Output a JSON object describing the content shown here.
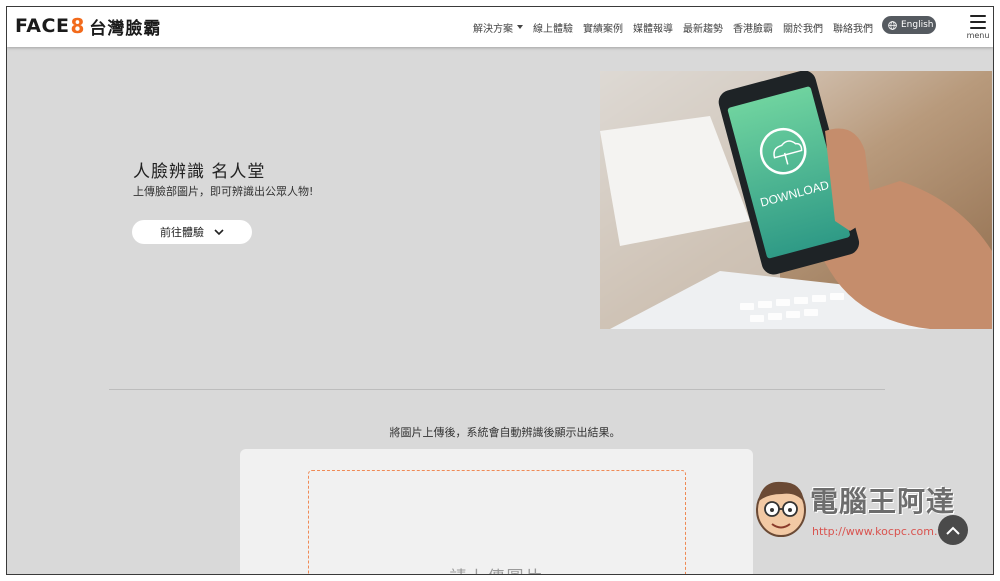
{
  "header": {
    "logo_face": "FACE",
    "logo_eight": "8",
    "logo_cn": "台灣臉霸",
    "nav": [
      {
        "label": "解決方案",
        "has_dropdown": true
      },
      {
        "label": "線上體驗"
      },
      {
        "label": "實績案例"
      },
      {
        "label": "媒體報導"
      },
      {
        "label": "最新趨勢"
      },
      {
        "label": "香港臉霸"
      },
      {
        "label": "關於我們"
      },
      {
        "label": "聯絡我們"
      }
    ],
    "language_label": "English",
    "menu_label": "menu"
  },
  "hero": {
    "title": "人臉辨識 名人堂",
    "subtitle": "上傳臉部圖片，即可辨識出公眾人物!",
    "try_button_label": "前往體驗",
    "image_caption": "DOWNLOAD"
  },
  "upload": {
    "note": "將圖片上傳後，系統會自動辨識後顯示出結果。",
    "drop_text": "請上傳圖片"
  },
  "watermark": {
    "title": "電腦王阿達",
    "url": "http://www.kocpc.com.tw"
  },
  "colors": {
    "accent": "#f26a1b",
    "page_bg": "#d9d9d9",
    "dashed_border": "#f08a55",
    "phone_screen": "#3fa882"
  }
}
